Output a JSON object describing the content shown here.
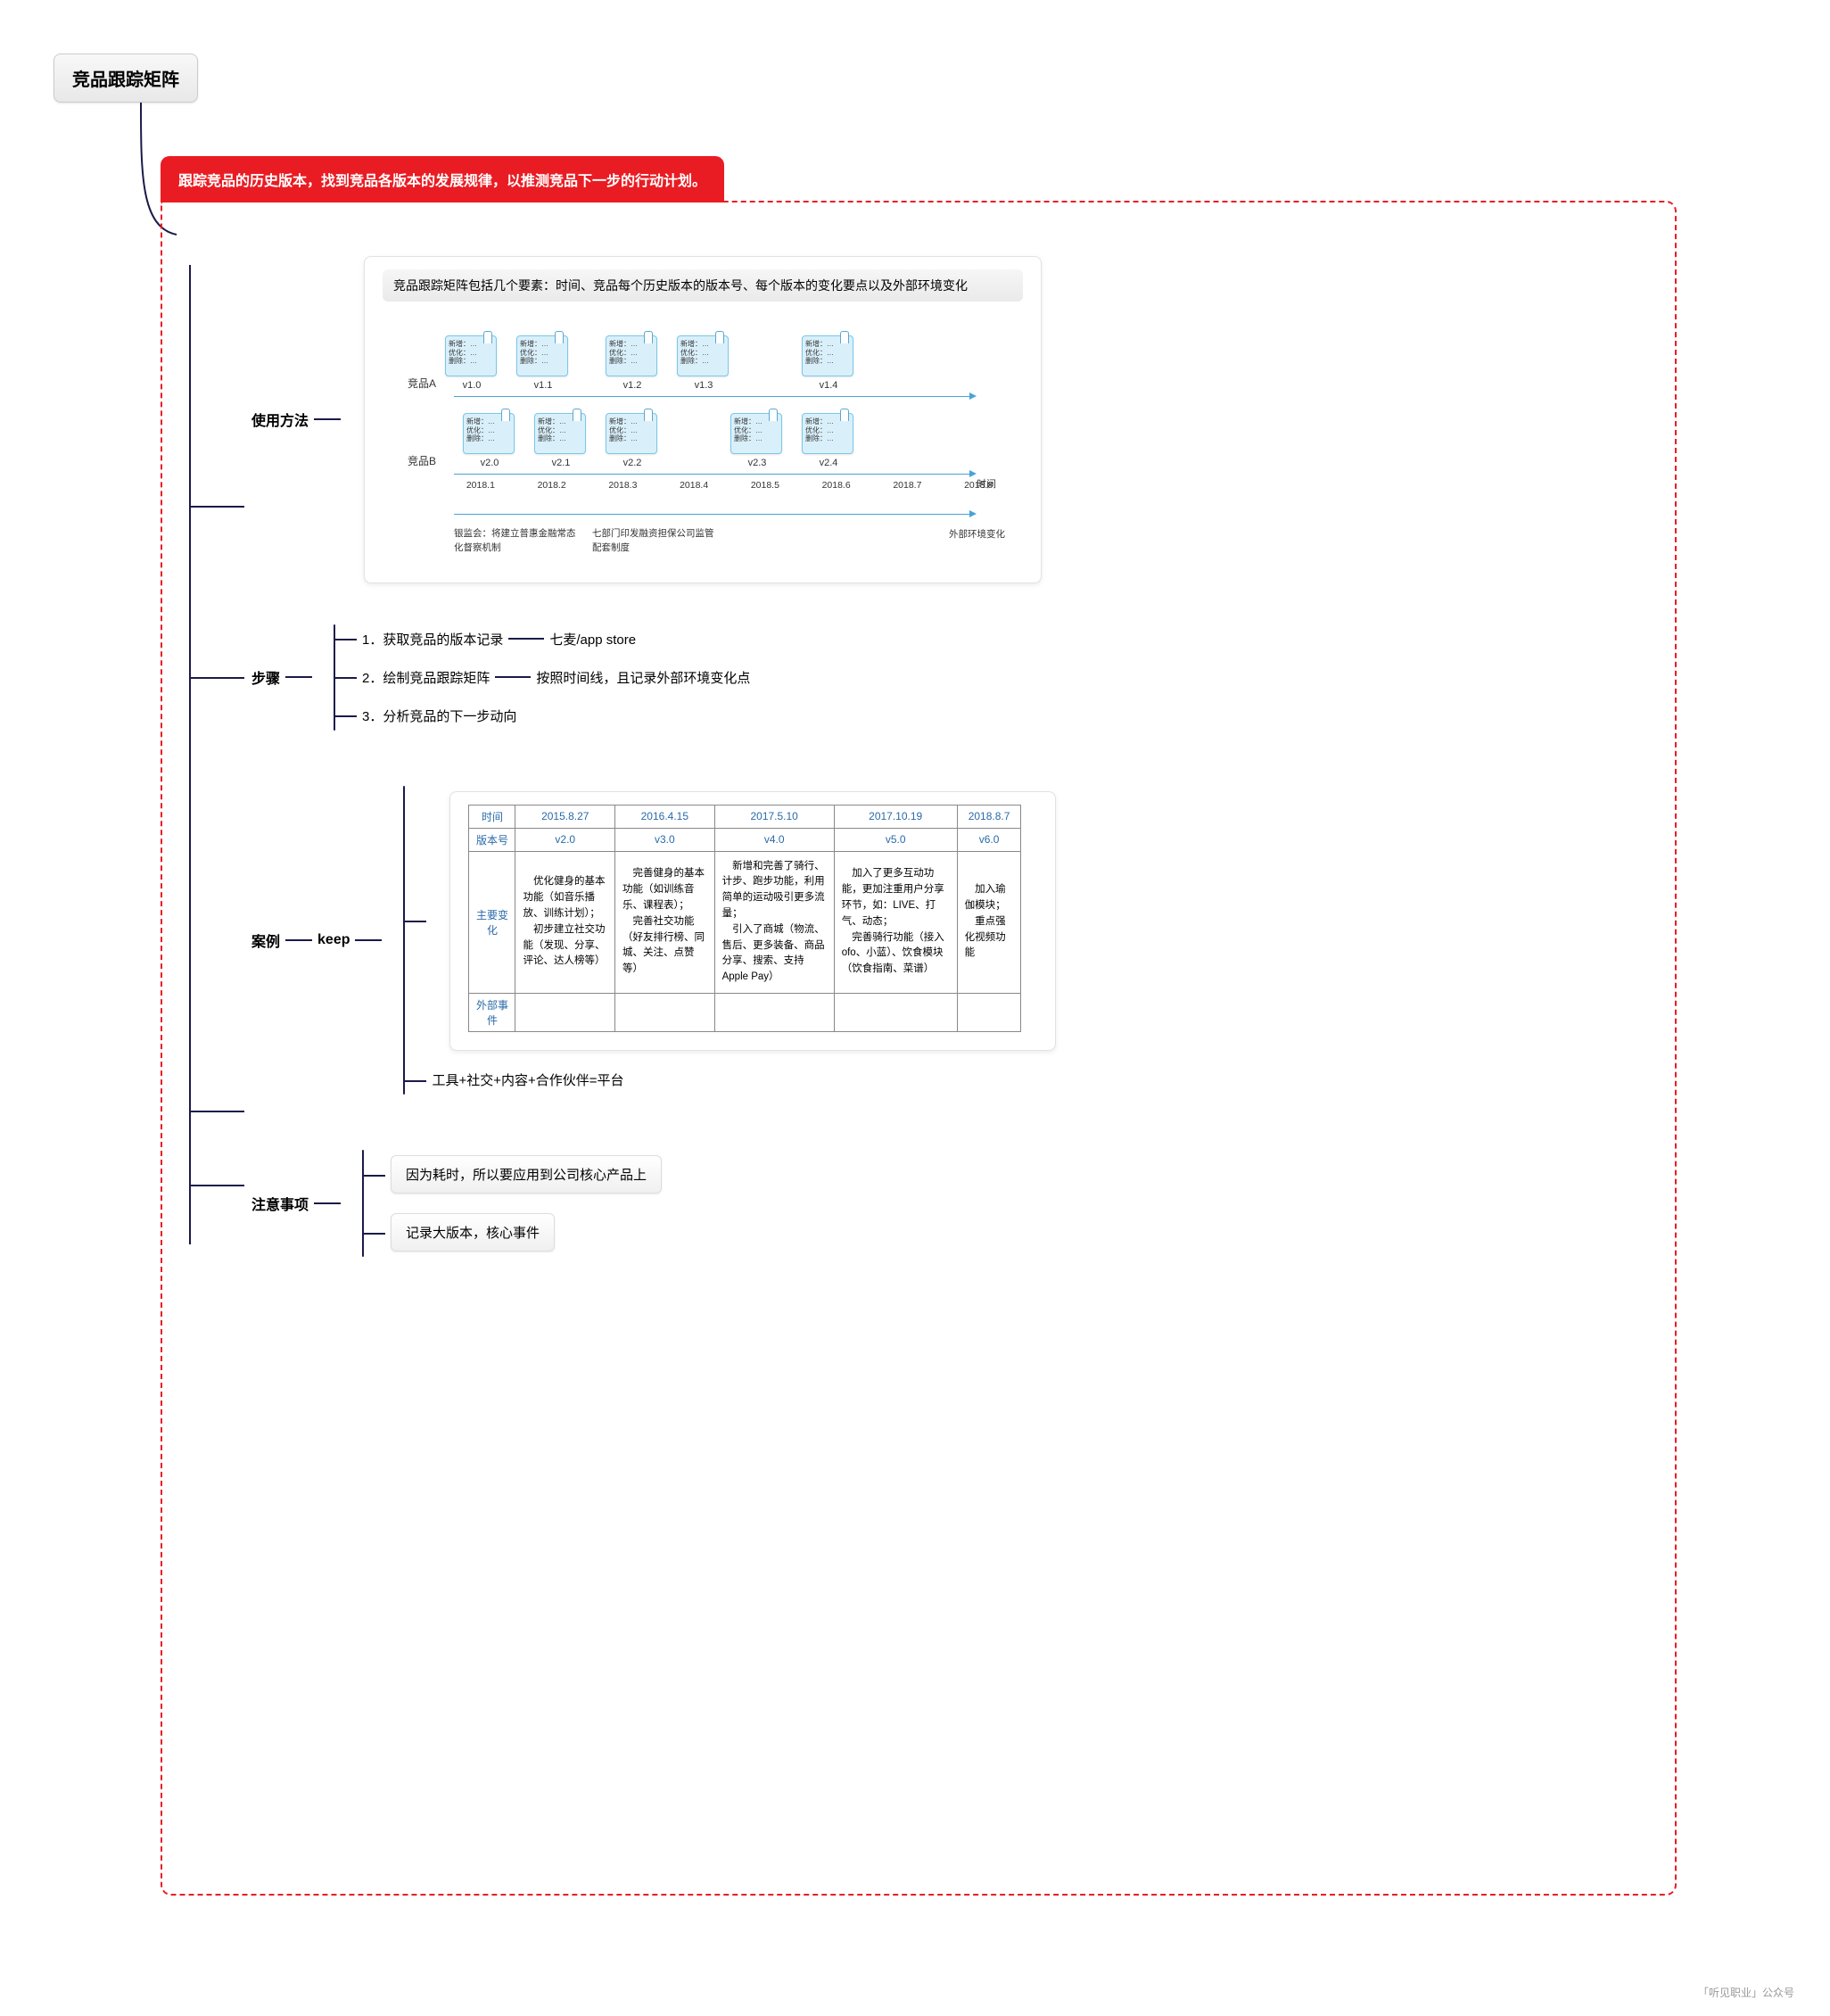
{
  "root": "竞品跟踪矩阵",
  "redTitle": "跟踪竞品的历史版本，找到竞品各版本的发展规律，以推测竞品下一步的行动计划。",
  "sections": {
    "usage": {
      "label": "使用方法",
      "matrixHeader": "竞品跟踪矩阵包括几个要素：时间、竞品每个历史版本的版本号、每个版本的变化要点以及外部环境变化",
      "rowA": {
        "label": "竞品A",
        "versions": [
          "v1.0",
          "v1.1",
          "v1.2",
          "v1.3",
          "v1.4"
        ]
      },
      "rowB": {
        "label": "竞品B",
        "versions": [
          "v2.0",
          "v2.1",
          "v2.2",
          "v2.3",
          "v2.4"
        ]
      },
      "cardLines": [
        "新增：…",
        "优化：…",
        "删除：…"
      ],
      "months": [
        "2018.1",
        "2018.2",
        "2018.3",
        "2018.4",
        "2018.5",
        "2018.6",
        "2018.7",
        "2018.8"
      ],
      "axisLabel": "时间",
      "envLabel": "外部环境变化",
      "envCol1": "银监会：将建立普惠金融常态化督察机制",
      "envCol2": "七部门印发融资担保公司监管配套制度"
    },
    "steps": {
      "label": "步骤",
      "items": [
        {
          "text": "1．获取竞品的版本记录",
          "tail": "七麦/app store"
        },
        {
          "text": "2．绘制竞品跟踪矩阵",
          "tail": "按照时间线，且记录外部环境变化点"
        },
        {
          "text": "3．分析竞品的下一步动向",
          "tail": ""
        }
      ]
    },
    "caseStudy": {
      "label": "案例",
      "product": "keep",
      "tableHeaders": {
        "time": "时间",
        "version": "版本号",
        "changes": "主要变化",
        "events": "外部事件"
      },
      "cols": [
        {
          "date": "2015.8.27",
          "ver": "v2.0",
          "chg": "　优化健身的基本功能（如音乐播放、训练计划）；\n　初步建立社交功能（发现、分享、评论、达人榜等）"
        },
        {
          "date": "2016.4.15",
          "ver": "v3.0",
          "chg": "　完善健身的基本功能（如训练音乐、课程表）；\n　完善社交功能（好友排行榜、同城、关注、点赞等）"
        },
        {
          "date": "2017.5.10",
          "ver": "v4.0",
          "chg": "　新增和完善了骑行、计步、跑步功能，利用简单的运动吸引更多流量；\n　引入了商城（物流、售后、更多装备、商品分享、搜索、支持 Apple Pay）"
        },
        {
          "date": "2017.10.19",
          "ver": "v5.0",
          "chg": "　加入了更多互动功能，更加注重用户分享环节，如：LIVE、打气、动态；\n　完善骑行功能（接入ofo、小蓝）、饮食模块（饮食指南、菜谱）"
        },
        {
          "date": "2018.8.7",
          "ver": "v6.0",
          "chg": "　加入瑜伽模块；\n　重点强化视频功能"
        }
      ],
      "summary": "工具+社交+内容+合作伙伴=平台"
    },
    "notes": {
      "label": "注意事项",
      "items": [
        "因为耗时，所以要应用到公司核心产品上",
        "记录大版本，核心事件"
      ]
    }
  },
  "watermark": "「听见职业」公众号"
}
